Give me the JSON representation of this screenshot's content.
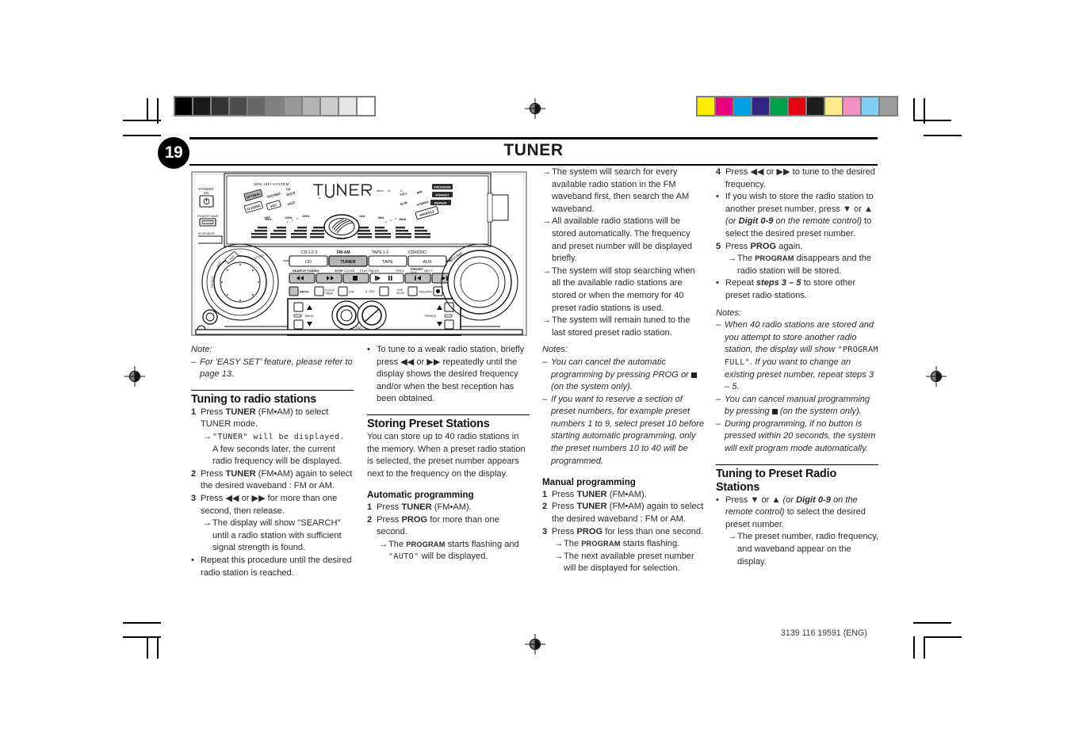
{
  "page": {
    "number": "19",
    "title": "TUNER",
    "footer_code": "3139 116 19591 (ENG)"
  },
  "marks": {
    "grayscale_bar": [
      "#000000",
      "#1a1a1a",
      "#333333",
      "#4d4d4d",
      "#666666",
      "#808080",
      "#999999",
      "#b3b3b3",
      "#cccccc",
      "#e6e6e6",
      "#ffffff"
    ],
    "color_bar": [
      "#ffed00",
      "#e6007e",
      "#00a0e3",
      "#312783",
      "#00a14b",
      "#e30613",
      "#1d1d1b",
      "#fdeb8a",
      "#f28fc0",
      "#7fd0f2",
      "#9d9d9c"
    ]
  },
  "device": {
    "brand_label": "MINI HIFI SYSTEM",
    "display_text": "TUNER",
    "standby_label": "STANDBY ON",
    "power_save_label": "POWER SAVE",
    "ir_sensor_label": "IR SENSOR",
    "volume_label": "VOLUME",
    "source_top_labels": [
      "CD 1-2-3",
      "FM-AM",
      "TAPE 1-2",
      "CDR/DVD"
    ],
    "source_buttons": [
      "CD",
      "TUNER",
      "TAPE",
      "AUX"
    ],
    "transport_top_labels": [
      "SEARCH·TUNING",
      "STOP·CLEAR",
      "PLAY PAUSE",
      "PREV",
      "PRESET SIDE",
      "NEXT"
    ],
    "small_buttons": [
      "PROG",
      "CLOCK/TIMER",
      "DIM",
      "A. REV",
      "DUB (HIGH)",
      "RECORD"
    ],
    "tone_labels": [
      "BASS",
      "TREBLE"
    ],
    "dbb_labels": [
      "PLUS",
      "DSC TECHNOLOGY",
      "LEVEL"
    ],
    "jog_labels": [
      "JAZZ",
      "ROCK",
      "OPTIMAL",
      "TECHNO",
      "CLASSIC",
      "VOC",
      "FLAT/JOG"
    ],
    "display_tags": [
      "FULL",
      "MIN",
      "PROGRAM",
      "SLIM",
      "FORGET",
      "STEREO",
      "REPEAT",
      "SHUFFLE"
    ]
  },
  "col1": {
    "note_title": "Note:",
    "note_items": [
      "For 'EASY SET' feature, please refer to page 13."
    ],
    "heading": "Tuning to radio stations",
    "steps": [
      {
        "n": "1",
        "pre": "Press ",
        "b": "TUNER",
        "post": " (FM•AM) to select TUNER mode."
      },
      {
        "n": "2",
        "pre": "Press ",
        "b": "TUNER",
        "post": " (FM•AM) again to select the desired waveband : FM or AM."
      },
      {
        "n": "3",
        "pre": "Press ◀◀ or ▶▶ for more than one second, then release.",
        "b": "",
        "post": ""
      }
    ],
    "arrow1_a": "\"TUNER\" will be displayed.",
    "arrow1_b": "A few seconds later, the current radio frequency will be displayed.",
    "arrow3": "The display will show \"SEARCH\" until a radio station with sufficient signal strength is found.",
    "bullet_last": "Repeat this procedure until the desired radio station is reached."
  },
  "col2": {
    "bullet_top": "To tune to a weak radio station, briefly press ◀◀ or ▶▶ repeatedly until the display shows the desired frequency and/or when the best reception has been obtained.",
    "heading": "Storing Preset Stations",
    "body": "You can store up to 40 radio stations in the memory. When a preset radio station is selected, the preset number appears next to the frequency on the display.",
    "sub_head": "Automatic programming",
    "steps": [
      {
        "n": "1",
        "pre": "Press ",
        "b": "TUNER",
        "post": " (FM•AM)."
      },
      {
        "n": "2",
        "pre": "Press ",
        "b": "PROG",
        "post": " for more than one second."
      }
    ],
    "arrow2_pre": "The ",
    "arrow2_sc": "PROGRAM",
    "arrow2_mid": " starts flashing and ",
    "arrow2_lcd": "\"AUTO\"",
    "arrow2_post": " will be displayed."
  },
  "col3": {
    "arrows": [
      "The system will search for every available radio station in the FM waveband first, then search the AM waveband.",
      "All available radio stations will be stored automatically. The frequency and preset number will be displayed briefly.",
      "The system  will stop searching when all the available radio stations are stored or when the memory for 40 preset radio stations is used.",
      "The system will remain tuned to the last stored preset radio station."
    ],
    "notes_title": "Notes:",
    "note1_pre": "You can cancel the automatic programming by pressing PROG or ",
    "note1_post": " (on the system only).",
    "note2": "If you want to reserve a section of preset numbers, for example preset numbers 1 to 9, select preset 10 before starting automatic programming, only the preset numbers 10 to 40 will be programmed.",
    "sub_head": "Manual programming",
    "steps": [
      {
        "n": "1",
        "pre": "Press ",
        "b": "TUNER",
        "post": " (FM•AM)."
      },
      {
        "n": "2",
        "pre": "Press ",
        "b": "TUNER",
        "post": " (FM•AM) again to select the desired waveband : FM or AM."
      },
      {
        "n": "3",
        "pre": "Press ",
        "b": "PROG",
        "post": " for less than one second."
      }
    ],
    "arrow3a_pre": "The ",
    "arrow3a_sc": "PROGRAM",
    "arrow3a_post": " starts flashing.",
    "arrow3b": "The next available preset number will be displayed for selection."
  },
  "col4": {
    "step4": {
      "n": "4",
      "text": "Press ◀◀ or ▶▶ to tune to the desired frequency."
    },
    "bullet1_a": "If you wish to store the radio station to another preset number, press ▼ or ▲ ",
    "bullet1_i1": "(or ",
    "bullet1_b": "Digit 0-9",
    "bullet1_i2": " on the remote control)",
    "bullet1_b2": " to select the desired preset number.",
    "step5": {
      "n": "5",
      "pre": "Press ",
      "b": "PROG",
      "post": " again."
    },
    "arrow5_pre": "The ",
    "arrow5_sc": "PROGRAM",
    "arrow5_post": " disappears and the radio station will be stored.",
    "bullet2_pre": "Repeat ",
    "bullet2_b": "steps 3 – 5",
    "bullet2_post": " to store other preset radio stations.",
    "notes_title": "Notes:",
    "note1_a": "When 40 radio stations are stored and you attempt to store another radio station, the display will show ",
    "note1_lcd": "\"PROGRAM FULL\"",
    "note1_b": ". If you want to change an existing preset number, repeat steps 3 – 5.",
    "note2_pre": "You can cancel manual programming by pressing ",
    "note2_post": " (on the system only).",
    "note3": "During programming,  if no button is pressed within 20 seconds, the system will exit program mode automatically.",
    "heading": "Tuning to Preset Radio Stations",
    "bullet3_a": "Press ▼ or ▲ ",
    "bullet3_i1": "(or ",
    "bullet3_b": "Digit 0-9",
    "bullet3_i2": " on the remote control)",
    "bullet3_post": " to select the desired preset number.",
    "arrow_last": "The preset number, radio frequency, and waveband appear on the display."
  }
}
